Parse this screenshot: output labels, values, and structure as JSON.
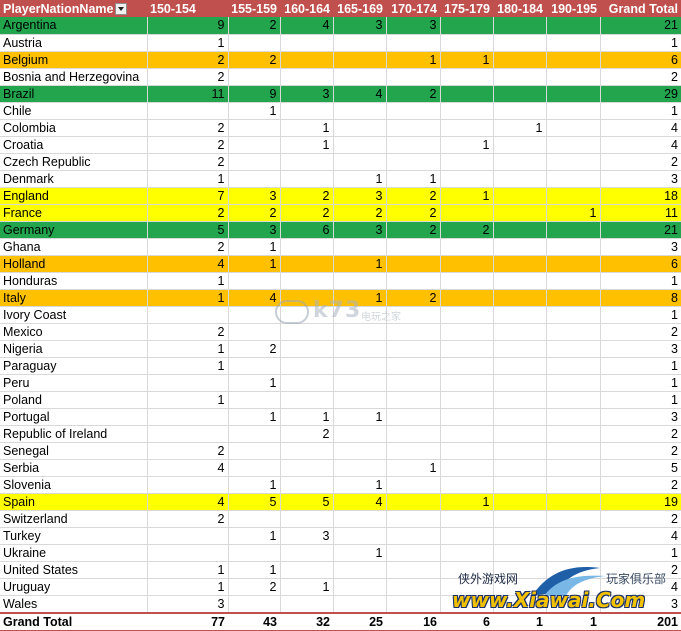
{
  "header": {
    "row_label": "PlayerNationName",
    "columns": [
      "150-154",
      "155-159",
      "160-164",
      "165-169",
      "170-174",
      "175-179",
      "180-184",
      "190-195",
      "Grand Total"
    ]
  },
  "rows": [
    {
      "name": "Argentina",
      "highlight": "green",
      "values": [
        "9",
        "2",
        "4",
        "3",
        "3",
        "",
        "",
        "",
        "21"
      ]
    },
    {
      "name": "Austria",
      "highlight": "",
      "values": [
        "1",
        "",
        "",
        "",
        "",
        "",
        "",
        "",
        "1"
      ]
    },
    {
      "name": "Belgium",
      "highlight": "orange",
      "values": [
        "2",
        "2",
        "",
        "",
        "1",
        "1",
        "",
        "",
        "6"
      ]
    },
    {
      "name": "Bosnia and Herzegovina",
      "highlight": "",
      "values": [
        "2",
        "",
        "",
        "",
        "",
        "",
        "",
        "",
        "2"
      ]
    },
    {
      "name": "Brazil",
      "highlight": "green",
      "values": [
        "11",
        "9",
        "3",
        "4",
        "2",
        "",
        "",
        "",
        "29"
      ]
    },
    {
      "name": "Chile",
      "highlight": "",
      "values": [
        "",
        "1",
        "",
        "",
        "",
        "",
        "",
        "",
        "1"
      ]
    },
    {
      "name": "Colombia",
      "highlight": "",
      "values": [
        "2",
        "",
        "1",
        "",
        "",
        "",
        "1",
        "",
        "4"
      ]
    },
    {
      "name": "Croatia",
      "highlight": "",
      "values": [
        "2",
        "",
        "1",
        "",
        "",
        "1",
        "",
        "",
        "4"
      ]
    },
    {
      "name": "Czech Republic",
      "highlight": "",
      "values": [
        "2",
        "",
        "",
        "",
        "",
        "",
        "",
        "",
        "2"
      ]
    },
    {
      "name": "Denmark",
      "highlight": "",
      "values": [
        "1",
        "",
        "",
        "1",
        "1",
        "",
        "",
        "",
        "3"
      ]
    },
    {
      "name": "England",
      "highlight": "yellow",
      "values": [
        "7",
        "3",
        "2",
        "3",
        "2",
        "1",
        "",
        "",
        "18"
      ]
    },
    {
      "name": "France",
      "highlight": "yellow",
      "values": [
        "2",
        "2",
        "2",
        "2",
        "2",
        "",
        "",
        "1",
        "11"
      ]
    },
    {
      "name": "Germany",
      "highlight": "green",
      "values": [
        "5",
        "3",
        "6",
        "3",
        "2",
        "2",
        "",
        "",
        "21"
      ]
    },
    {
      "name": "Ghana",
      "highlight": "",
      "values": [
        "2",
        "1",
        "",
        "",
        "",
        "",
        "",
        "",
        "3"
      ]
    },
    {
      "name": "Holland",
      "highlight": "orange",
      "values": [
        "4",
        "1",
        "",
        "1",
        "",
        "",
        "",
        "",
        "6"
      ]
    },
    {
      "name": "Honduras",
      "highlight": "",
      "values": [
        "1",
        "",
        "",
        "",
        "",
        "",
        "",
        "",
        "1"
      ]
    },
    {
      "name": "Italy",
      "highlight": "orange",
      "values": [
        "1",
        "4",
        "",
        "1",
        "2",
        "",
        "",
        "",
        "8"
      ]
    },
    {
      "name": "Ivory Coast",
      "highlight": "",
      "values": [
        "",
        "",
        "",
        "",
        "",
        "",
        "",
        "",
        "1"
      ]
    },
    {
      "name": "Mexico",
      "highlight": "",
      "values": [
        "2",
        "",
        "",
        "",
        "",
        "",
        "",
        "",
        "2"
      ]
    },
    {
      "name": "Nigeria",
      "highlight": "",
      "values": [
        "1",
        "2",
        "",
        "",
        "",
        "",
        "",
        "",
        "3"
      ]
    },
    {
      "name": "Paraguay",
      "highlight": "",
      "values": [
        "1",
        "",
        "",
        "",
        "",
        "",
        "",
        "",
        "1"
      ]
    },
    {
      "name": "Peru",
      "highlight": "",
      "values": [
        "",
        "1",
        "",
        "",
        "",
        "",
        "",
        "",
        "1"
      ]
    },
    {
      "name": "Poland",
      "highlight": "",
      "values": [
        "1",
        "",
        "",
        "",
        "",
        "",
        "",
        "",
        "1"
      ]
    },
    {
      "name": "Portugal",
      "highlight": "",
      "values": [
        "",
        "1",
        "1",
        "1",
        "",
        "",
        "",
        "",
        "3"
      ]
    },
    {
      "name": "Republic of Ireland",
      "highlight": "",
      "values": [
        "",
        "",
        "2",
        "",
        "",
        "",
        "",
        "",
        "2"
      ]
    },
    {
      "name": "Senegal",
      "highlight": "",
      "values": [
        "2",
        "",
        "",
        "",
        "",
        "",
        "",
        "",
        "2"
      ]
    },
    {
      "name": "Serbia",
      "highlight": "",
      "values": [
        "4",
        "",
        "",
        "",
        "1",
        "",
        "",
        "",
        "5"
      ]
    },
    {
      "name": "Slovenia",
      "highlight": "",
      "values": [
        "",
        "1",
        "",
        "1",
        "",
        "",
        "",
        "",
        "2"
      ]
    },
    {
      "name": "Spain",
      "highlight": "yellow",
      "values": [
        "4",
        "5",
        "5",
        "4",
        "",
        "1",
        "",
        "",
        "19"
      ]
    },
    {
      "name": "Switzerland",
      "highlight": "",
      "values": [
        "2",
        "",
        "",
        "",
        "",
        "",
        "",
        "",
        "2"
      ]
    },
    {
      "name": "Turkey",
      "highlight": "",
      "values": [
        "",
        "1",
        "3",
        "",
        "",
        "",
        "",
        "",
        "4"
      ]
    },
    {
      "name": "Ukraine",
      "highlight": "",
      "values": [
        "",
        "",
        "",
        "1",
        "",
        "",
        "",
        "",
        "1"
      ]
    },
    {
      "name": "United States",
      "highlight": "",
      "values": [
        "1",
        "1",
        "",
        "",
        "",
        "",
        "",
        "",
        "2"
      ]
    },
    {
      "name": "Uruguay",
      "highlight": "",
      "values": [
        "1",
        "2",
        "1",
        "",
        "",
        "",
        "",
        "",
        "4"
      ]
    },
    {
      "name": "Wales",
      "highlight": "",
      "values": [
        "3",
        "",
        "",
        "",
        "",
        "",
        "",
        "",
        "3"
      ]
    }
  ],
  "footer": {
    "label": "Grand Total",
    "values": [
      "77",
      "43",
      "32",
      "25",
      "16",
      "6",
      "1",
      "1",
      "201"
    ]
  },
  "colors": {
    "header": "#c0504d",
    "green": "#22a54d",
    "orange": "#ffc000",
    "yellow": "#ffff00"
  },
  "watermarks": {
    "k73_text": "k73",
    "k73_sub": "电玩之家",
    "xiawai_left": "侠外游戏网",
    "xiawai_right": "玩家俱乐部",
    "xiawai_url": "www.Xiawai.Com"
  }
}
